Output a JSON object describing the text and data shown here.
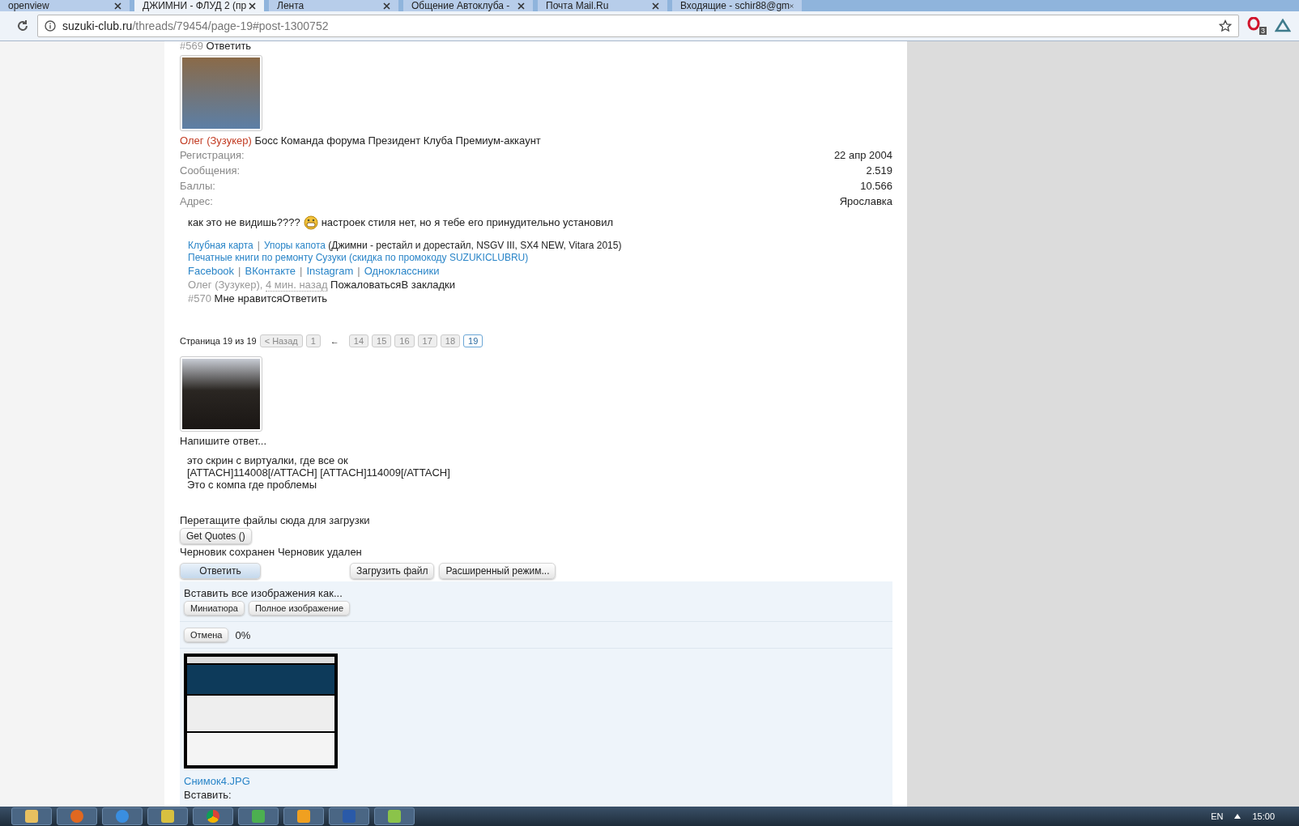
{
  "browser": {
    "tabs": [
      {
        "title": "openview",
        "selected": false
      },
      {
        "title": "ДЖИМНИ - ФЛУД 2 (пр",
        "selected": true
      },
      {
        "title": "Лента",
        "selected": false
      },
      {
        "title": "Общение Автоклуба - ",
        "selected": false
      },
      {
        "title": "Почта Mail.Ru",
        "selected": false
      },
      {
        "title": "Входящие - schir88@gm",
        "selected": false
      }
    ],
    "url_host": "suzuki-club.ru",
    "url_path": "/threads/79454/page-19#post-1300752",
    "extension_badge": "3"
  },
  "prev_post": {
    "number": "#569",
    "reply": "Ответить"
  },
  "post": {
    "author": "Олег (Зузукер)",
    "titles": "Босс Команда форума Президент Клуба Премиум-аккаунт",
    "stats": [
      {
        "label": "Регистрация:",
        "value": "22 апр 2004"
      },
      {
        "label": "Сообщения:",
        "value": "2.519"
      },
      {
        "label": "Баллы:",
        "value": "10.566"
      },
      {
        "label": "Адрес:",
        "value": "Ярославка"
      }
    ],
    "message_before": "как это не видишь????",
    "message_after": "настроек стиля нет, но я тебе его принудительно установил",
    "signature": {
      "links_1": [
        "Клубная карта",
        "Упоры капота"
      ],
      "note": "(Джимни - рестайл и дорестайл, NSGV III, SX4 NEW, Vitara 2015)",
      "promo": "Печатные книги по ремонту Сузуки (скидка по промокоду SUZUKICLUBRU)",
      "links_2": [
        "Facebook",
        "ВКонтакте",
        "Instagram",
        "Одноклассники"
      ],
      "separator": "|"
    },
    "meta_author": "Олег (Зузукер),",
    "meta_time": "4 мин. назад",
    "meta_actions": [
      "Пожаловаться",
      "В закладки"
    ],
    "number": "#570",
    "actions": [
      "Мне нравится",
      "Ответить"
    ]
  },
  "pagination": {
    "label": "Страница 19 из 19",
    "prev": "< Назад",
    "pages": [
      {
        "label": "1",
        "selected": false
      },
      {
        "label": "14",
        "selected": false
      },
      {
        "label": "15",
        "selected": false
      },
      {
        "label": "16",
        "selected": false
      },
      {
        "label": "17",
        "selected": false
      },
      {
        "label": "18",
        "selected": false
      },
      {
        "label": "19",
        "selected": true
      }
    ],
    "gap": "←"
  },
  "reply": {
    "placeholder": "Напишите ответ...",
    "lines": [
      "это скрин с виртуалки, где все ок",
      "[ATTACH]114008[/ATTACH] [ATTACH]114009[/ATTACH]",
      "Это с компа где проблемы"
    ],
    "drop_hint": "Перетащите файлы сюда для загрузки",
    "quotes_button": "Get Quotes ()",
    "draft_saved": "Черновик сохранен",
    "draft_deleted": "Черновик удален",
    "submit": "Ответить",
    "upload": "Загрузить файл",
    "advanced": "Расширенный режим..."
  },
  "upload_panel": {
    "insert_all": "Вставить все изображения как...",
    "insert_buttons": [
      "Миниатюра",
      "Полное изображение"
    ],
    "cancel": "Отмена",
    "progress": "0%",
    "file_name": "Снимок4.JPG",
    "insert_label": "Вставить:"
  },
  "taskbar": {
    "language": "EN",
    "time": "15:00"
  }
}
